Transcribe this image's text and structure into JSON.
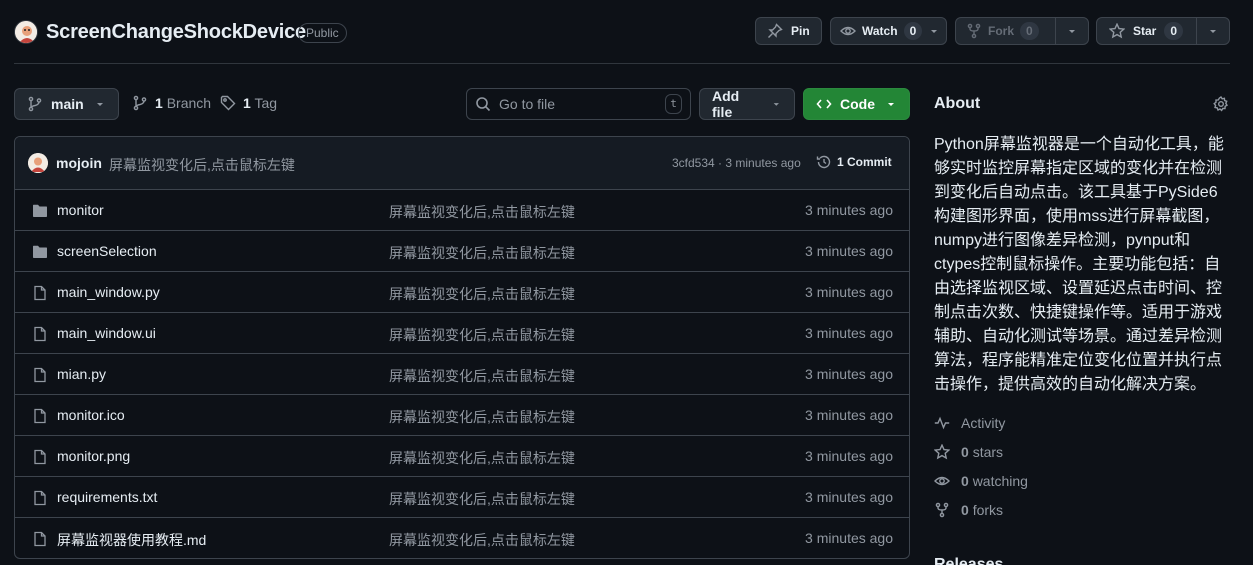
{
  "repo": {
    "name": "ScreenChangeShockDevice",
    "visibility": "Public"
  },
  "header_actions": {
    "pin_label": "Pin",
    "watch_label": "Watch",
    "watch_count": "0",
    "fork_label": "Fork",
    "fork_count": "0",
    "star_label": "Star",
    "star_count": "0"
  },
  "toolbar": {
    "branch": "main",
    "branches_count": "1",
    "branches_label": "Branch",
    "tags_count": "1",
    "tags_label": "Tag",
    "goto_placeholder": "Go to file",
    "goto_shortcut": "t",
    "add_file_label": "Add file",
    "code_label": "Code"
  },
  "latest_commit": {
    "author": "mojoin",
    "message": "屏幕监视变化后,点击鼠标左键",
    "sha_time": "3cfd534 · 3 minutes ago",
    "commits_label": "1 Commit"
  },
  "files": [
    {
      "name": "monitor",
      "type": "folder",
      "message": "屏幕监视变化后,点击鼠标左键",
      "time": "3 minutes ago"
    },
    {
      "name": "screenSelection",
      "type": "folder",
      "message": "屏幕监视变化后,点击鼠标左键",
      "time": "3 minutes ago"
    },
    {
      "name": "main_window.py",
      "type": "file",
      "message": "屏幕监视变化后,点击鼠标左键",
      "time": "3 minutes ago"
    },
    {
      "name": "main_window.ui",
      "type": "file",
      "message": "屏幕监视变化后,点击鼠标左键",
      "time": "3 minutes ago"
    },
    {
      "name": "mian.py",
      "type": "file",
      "message": "屏幕监视变化后,点击鼠标左键",
      "time": "3 minutes ago"
    },
    {
      "name": "monitor.ico",
      "type": "file",
      "message": "屏幕监视变化后,点击鼠标左键",
      "time": "3 minutes ago"
    },
    {
      "name": "monitor.png",
      "type": "file",
      "message": "屏幕监视变化后,点击鼠标左键",
      "time": "3 minutes ago"
    },
    {
      "name": "requirements.txt",
      "type": "file",
      "message": "屏幕监视变化后,点击鼠标左键",
      "time": "3 minutes ago"
    },
    {
      "name": "屏幕监视器使用教程.md",
      "type": "file",
      "message": "屏幕监视变化后,点击鼠标左键",
      "time": "3 minutes ago"
    }
  ],
  "about": {
    "title": "About",
    "description": "Python屏幕监视器是一个自动化工具，能够实时监控屏幕指定区域的变化并在检测到变化后自动点击。该工具基于PySide6构建图形界面，使用mss进行屏幕截图，numpy进行图像差异检测，pynput和ctypes控制鼠标操作。主要功能包括：自由选择监视区域、设置延迟点击时间、控制点击次数、快捷键操作等。适用于游戏辅助、自动化测试等场景。通过差异检测算法，程序能精准定位变化位置并执行点击操作，提供高效的自动化解决方案。",
    "activity_label": "Activity",
    "stars_count": "0",
    "stars_label": "stars",
    "watching_count": "0",
    "watching_label": "watching",
    "forks_count": "0",
    "forks_label": "forks"
  },
  "releases_title": "Releases",
  "colors": {
    "background": "#0d1117",
    "border": "#3d444d",
    "code_button": "#238636",
    "muted_text": "#9198a1"
  }
}
